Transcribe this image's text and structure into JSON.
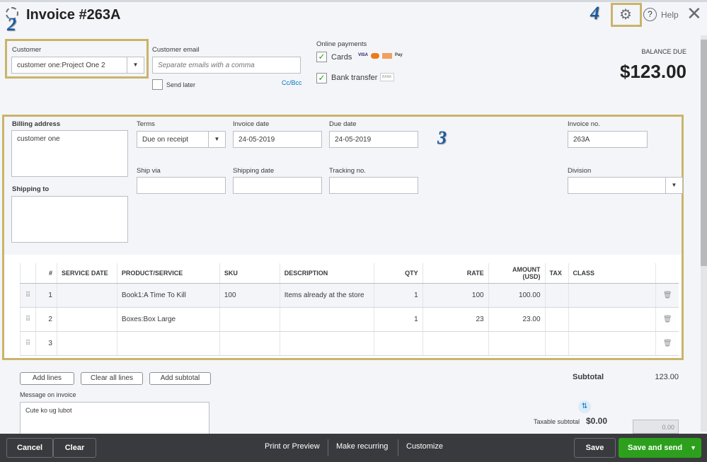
{
  "header": {
    "title": "Invoice #263A",
    "help": "Help",
    "icons": [
      "history-icon",
      "gear-icon",
      "help-icon",
      "close-icon"
    ]
  },
  "annotations": [
    "2",
    "3",
    "4"
  ],
  "customer": {
    "label": "Customer",
    "value": "customer one:Project One 2"
  },
  "email": {
    "label": "Customer email",
    "placeholder": "Separate emails with a comma",
    "send_later": "Send later",
    "ccbcc": "Cc/Bcc"
  },
  "online_payments": {
    "label": "Online payments",
    "cards": "Cards",
    "cards_checked": true,
    "bank": "Bank transfer",
    "bank_checked": true,
    "card_logos": [
      "VISA",
      "mastercard",
      "DISCOVER",
      "Pay"
    ],
    "bank_badge": "BANK"
  },
  "balance": {
    "label": "BALANCE DUE",
    "amount": "$123.00"
  },
  "billing": {
    "label": "Billing address",
    "value": "customer one",
    "shipping_label": "Shipping to"
  },
  "terms": {
    "label": "Terms",
    "value": "Due on receipt"
  },
  "invoice_date": {
    "label": "Invoice date",
    "value": "24-05-2019"
  },
  "due_date": {
    "label": "Due date",
    "value": "24-05-2019"
  },
  "invoice_no": {
    "label": "Invoice no.",
    "value": "263A"
  },
  "ship_via": {
    "label": "Ship via"
  },
  "shipping_date": {
    "label": "Shipping date"
  },
  "tracking": {
    "label": "Tracking no."
  },
  "division": {
    "label": "Division"
  },
  "table": {
    "headers": [
      "#",
      "SERVICE DATE",
      "PRODUCT/SERVICE",
      "SKU",
      "DESCRIPTION",
      "QTY",
      "RATE",
      "AMOUNT (USD)",
      "TAX",
      "CLASS"
    ],
    "rows": [
      {
        "n": "1",
        "date": "",
        "product": "Book1:A Time To Kill",
        "sku": "100",
        "desc": "Items already at the store",
        "qty": "1",
        "rate": "100",
        "amount": "100.00"
      },
      {
        "n": "2",
        "date": "",
        "product": "Boxes:Box Large",
        "sku": "",
        "desc": "",
        "qty": "1",
        "rate": "23",
        "amount": "23.00"
      },
      {
        "n": "3",
        "date": "",
        "product": "",
        "sku": "",
        "desc": "",
        "qty": "",
        "rate": "",
        "amount": ""
      }
    ]
  },
  "actions": {
    "add_lines": "Add lines",
    "clear_all": "Clear all lines",
    "add_subtotal": "Add subtotal"
  },
  "message": {
    "label": "Message on invoice",
    "value": "Cute ko ug lubot"
  },
  "totals": {
    "subtotal_label": "Subtotal",
    "subtotal": "123.00",
    "taxable_label": "Taxable subtotal",
    "taxable": "$0.00",
    "tax_value": "0.00"
  },
  "footer": {
    "cancel": "Cancel",
    "clear": "Clear",
    "print": "Print or Preview",
    "recurring": "Make recurring",
    "customize": "Customize",
    "save": "Save",
    "save_send": "Save and send"
  },
  "colors": {
    "accent_green": "#2ca01c",
    "highlight": "#c9b46a",
    "footer_bg": "#393a3d"
  }
}
